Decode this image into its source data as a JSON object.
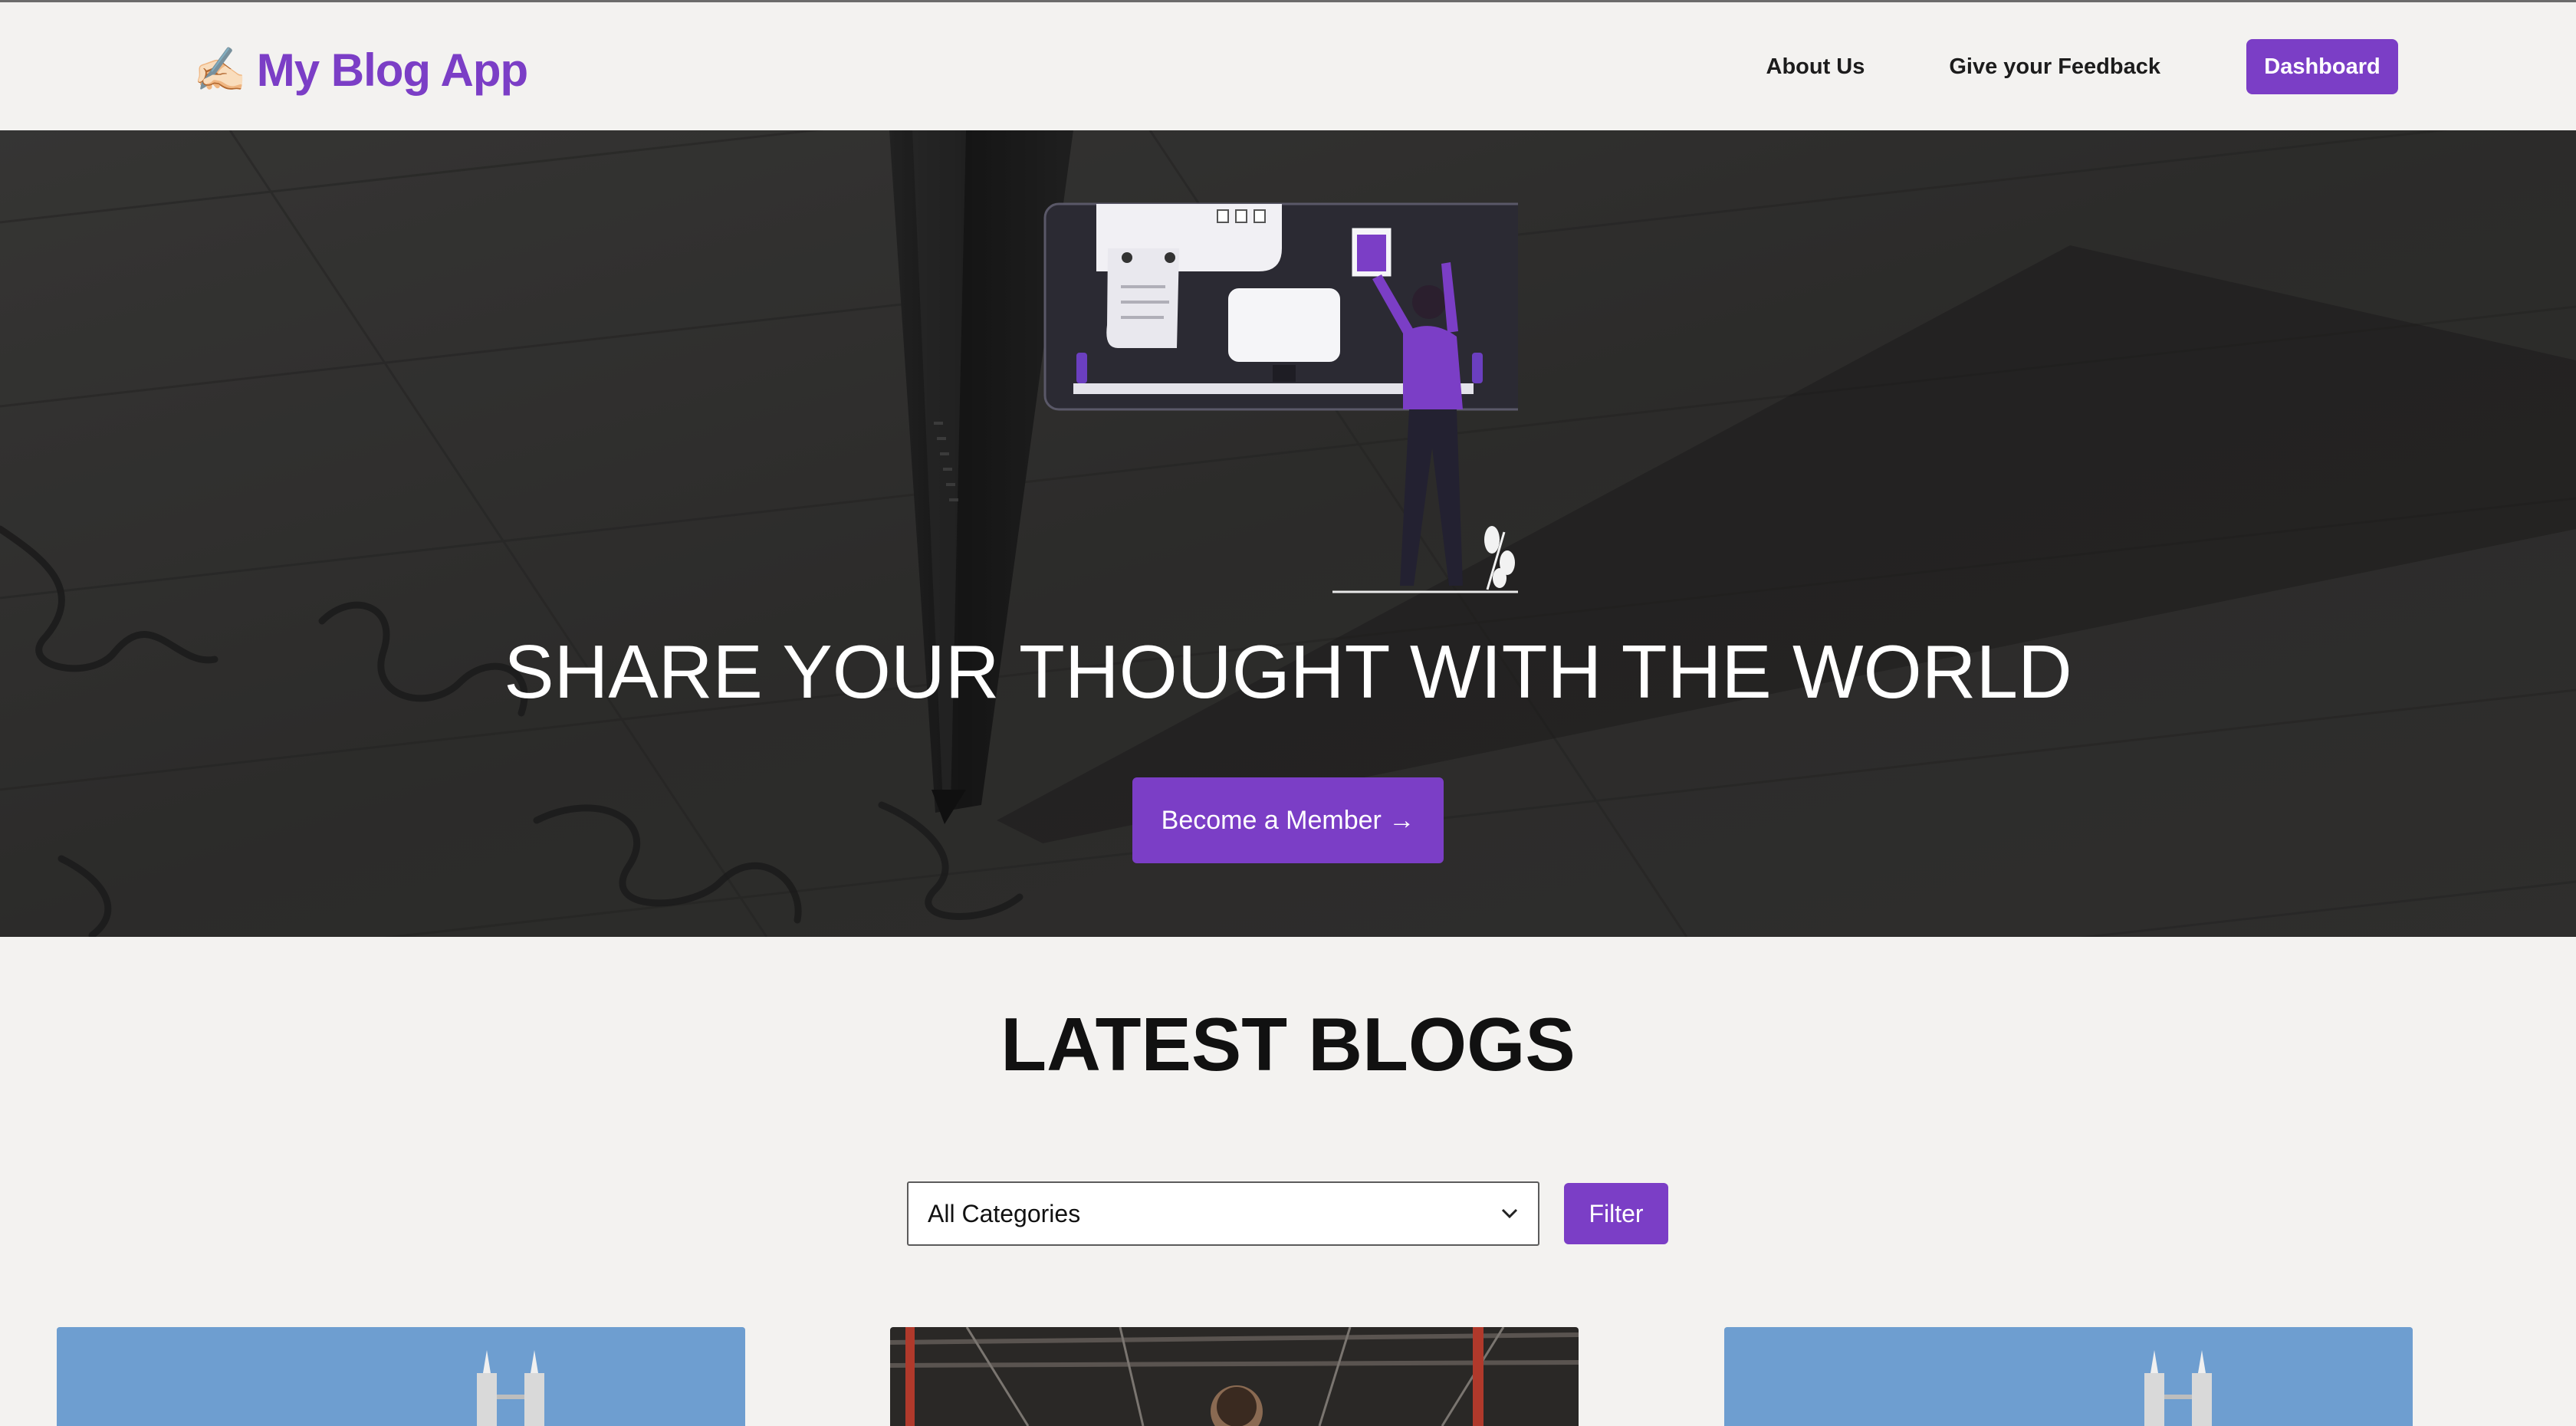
{
  "brand": {
    "icon": "writing-hand-icon",
    "name": "My Blog App"
  },
  "nav": {
    "about": "About Us",
    "feedback": "Give your Feedback",
    "dashboard": "Dashboard"
  },
  "hero": {
    "title": "SHARE YOUR THOUGHT WITH THE WORLD",
    "cta": "Become a Member →"
  },
  "latest": {
    "title": "LATEST BLOGS",
    "filter_select_value": "All Categories",
    "filter_button": "Filter"
  },
  "cards": [
    {
      "image": "city-towers-photo"
    },
    {
      "image": "person-in-workshop-photo"
    },
    {
      "image": "city-towers-photo"
    }
  ],
  "colors": {
    "accent": "#7b3ec6",
    "page_bg": "#f3f2f0",
    "text": "#111111"
  }
}
